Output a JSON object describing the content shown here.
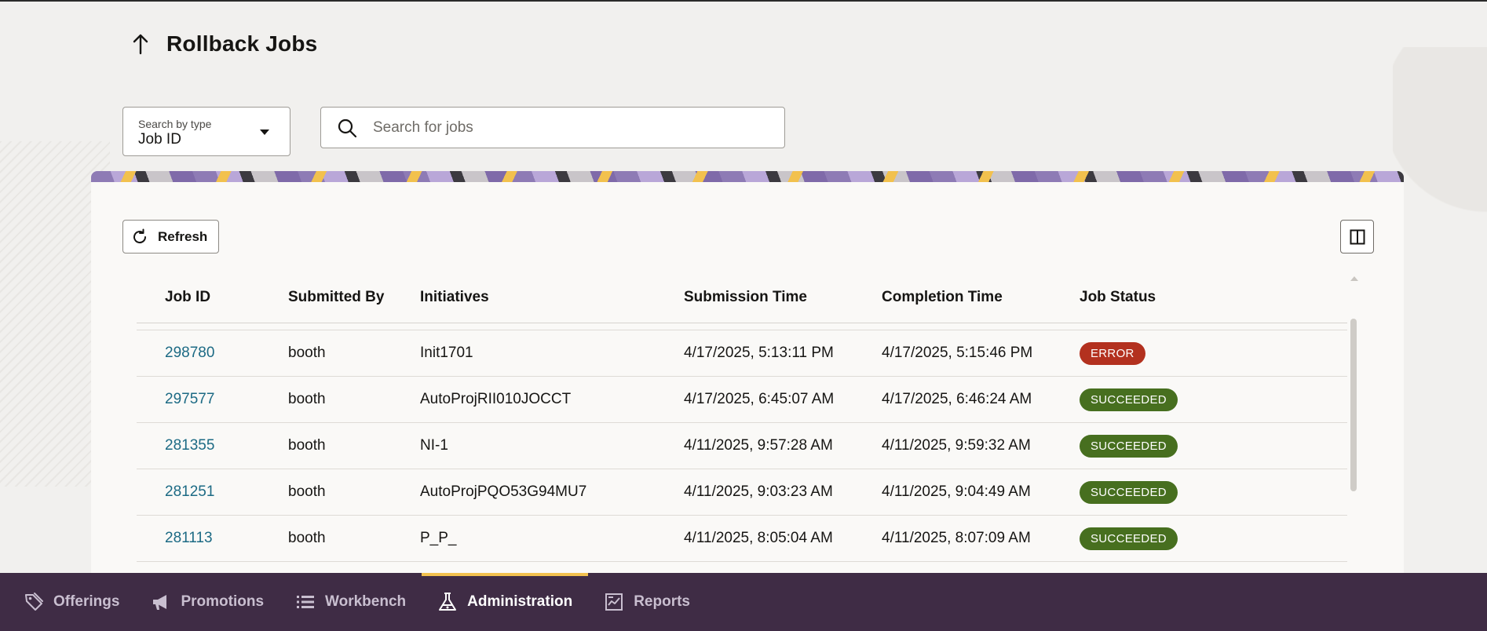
{
  "page": {
    "title": "Rollback Jobs"
  },
  "search_type": {
    "label": "Search by type",
    "value": "Job ID"
  },
  "search": {
    "placeholder": "Search for jobs"
  },
  "toolbar": {
    "refresh_label": "Refresh"
  },
  "table": {
    "columns": [
      "Job ID",
      "Submitted By",
      "Initiatives",
      "Submission Time",
      "Completion Time",
      "Job Status"
    ],
    "rows": [
      {
        "job_id": "298780",
        "submitted_by": "booth",
        "initiatives": "Init1701",
        "submission_time": "4/17/2025, 5:13:11 PM",
        "completion_time": "4/17/2025, 5:15:46 PM",
        "status": "ERROR"
      },
      {
        "job_id": "297577",
        "submitted_by": "booth",
        "initiatives": "AutoProjRII010JOCCT",
        "submission_time": "4/17/2025, 6:45:07 AM",
        "completion_time": "4/17/2025, 6:46:24 AM",
        "status": "SUCCEEDED"
      },
      {
        "job_id": "281355",
        "submitted_by": "booth",
        "initiatives": "NI-1",
        "submission_time": "4/11/2025, 9:57:28 AM",
        "completion_time": "4/11/2025, 9:59:32 AM",
        "status": "SUCCEEDED"
      },
      {
        "job_id": "281251",
        "submitted_by": "booth",
        "initiatives": "AutoProjPQO53G94MU7",
        "submission_time": "4/11/2025, 9:03:23 AM",
        "completion_time": "4/11/2025, 9:04:49 AM",
        "status": "SUCCEEDED"
      },
      {
        "job_id": "281113",
        "submitted_by": "booth",
        "initiatives": "P_P_",
        "submission_time": "4/11/2025, 8:05:04 AM",
        "completion_time": "4/11/2025, 8:07:09 AM",
        "status": "SUCCEEDED"
      }
    ]
  },
  "bottom_nav": {
    "items": [
      {
        "label": "Offerings",
        "icon": "tag-icon"
      },
      {
        "label": "Promotions",
        "icon": "megaphone-icon"
      },
      {
        "label": "Workbench",
        "icon": "list-icon"
      },
      {
        "label": "Administration",
        "icon": "flask-icon",
        "active": true
      },
      {
        "label": "Reports",
        "icon": "report-icon"
      }
    ]
  },
  "colors": {
    "link": "#1c6a84",
    "error_badge": "#b3311f",
    "success_badge": "#476f1f",
    "nav_background": "#3f2c45",
    "nav_active_indicator": "#f2c14e"
  }
}
